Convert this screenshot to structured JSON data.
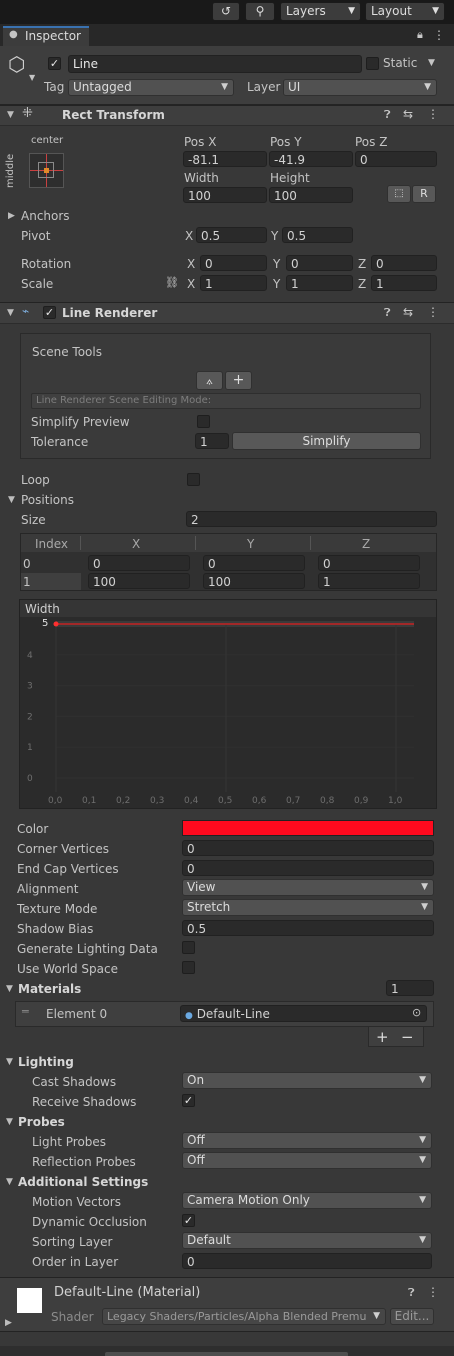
{
  "toolbar": {
    "layers": "Layers",
    "layout": "Layout"
  },
  "tab": {
    "title": "Inspector"
  },
  "object": {
    "name": "Line",
    "static_label": "Static",
    "tag_label": "Tag",
    "tag_value": "Untagged",
    "layer_label": "Layer",
    "layer_value": "UI"
  },
  "rect_transform": {
    "title": "Rect Transform",
    "anchor_h": "center",
    "anchor_v": "middle",
    "pos_x_label": "Pos X",
    "pos_y_label": "Pos Y",
    "pos_z_label": "Pos Z",
    "pos_x": "-81.1",
    "pos_y": "-41.9",
    "pos_z": "0",
    "width_label": "Width",
    "height_label": "Height",
    "width": "100",
    "height": "100",
    "r_button": "R",
    "anchors_label": "Anchors",
    "pivot_label": "Pivot",
    "pivot_x": "0.5",
    "pivot_y": "0.5",
    "rotation_label": "Rotation",
    "rot_x": "0",
    "rot_y": "0",
    "rot_z": "0",
    "scale_label": "Scale",
    "scale_x": "1",
    "scale_y": "1",
    "scale_z": "1",
    "axis_x": "X",
    "axis_y": "Y",
    "axis_z": "Z"
  },
  "line_renderer": {
    "title": "Line Renderer",
    "scene_tools": "Scene Tools",
    "editing_mode": "Line Renderer Scene Editing Mode:",
    "simplify_preview": "Simplify Preview",
    "tolerance_label": "Tolerance",
    "tolerance": "1",
    "simplify_button": "Simplify",
    "loop_label": "Loop",
    "positions_label": "Positions",
    "size_label": "Size",
    "size": "2",
    "columns": [
      "Index",
      "X",
      "Y",
      "Z"
    ],
    "rows": [
      {
        "index": "0",
        "x": "0",
        "y": "0",
        "z": "0"
      },
      {
        "index": "1",
        "x": "100",
        "y": "100",
        "z": "1"
      }
    ],
    "width_label": "Width",
    "width_curve": {
      "value": "5",
      "y_ticks": [
        "4",
        "3",
        "2",
        "1",
        "0"
      ],
      "x_ticks": [
        "0,0",
        "0,1",
        "0,2",
        "0,3",
        "0,4",
        "0,5",
        "0,6",
        "0,7",
        "0,8",
        "0,9",
        "1,0"
      ]
    },
    "color_label": "Color",
    "color_value": "#ff0a1e",
    "corner_vertices_label": "Corner Vertices",
    "corner_vertices": "0",
    "end_cap_label": "End Cap Vertices",
    "end_cap": "0",
    "alignment_label": "Alignment",
    "alignment": "View",
    "texture_mode_label": "Texture Mode",
    "texture_mode": "Stretch",
    "shadow_bias_label": "Shadow Bias",
    "shadow_bias": "0.5",
    "gen_lighting_label": "Generate Lighting Data",
    "world_space_label": "Use World Space",
    "materials_label": "Materials",
    "materials_count": "1",
    "element0_label": "Element 0",
    "element0_value": "Default-Line",
    "lighting_label": "Lighting",
    "cast_shadows_label": "Cast Shadows",
    "cast_shadows": "On",
    "receive_shadows_label": "Receive Shadows",
    "probes_label": "Probes",
    "light_probes_label": "Light Probes",
    "light_probes": "Off",
    "reflection_probes_label": "Reflection Probes",
    "reflection_probes": "Off",
    "additional_label": "Additional Settings",
    "motion_vectors_label": "Motion Vectors",
    "motion_vectors": "Camera Motion Only",
    "dynamic_occlusion_label": "Dynamic Occlusion",
    "sorting_layer_label": "Sorting Layer",
    "sorting_layer": "Default",
    "order_label": "Order in Layer",
    "order": "0"
  },
  "material": {
    "title": "Default-Line (Material)",
    "shader_label": "Shader",
    "shader_value": "Legacy Shaders/Particles/Alpha Blended Premu",
    "edit_button": "Edit..."
  }
}
